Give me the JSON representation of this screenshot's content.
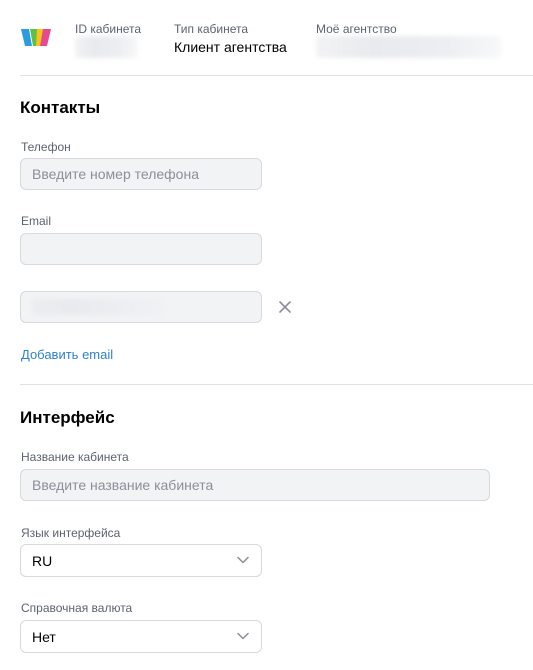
{
  "header": {
    "logo": "colorful-bars-logo",
    "cabinet_id_label": "ID кабинета",
    "cabinet_type_label": "Тип кабинета",
    "cabinet_type_value": "Клиент агентства",
    "agency_label": "Моё агентство"
  },
  "contacts": {
    "title": "Контакты",
    "phone_label": "Телефон",
    "phone_placeholder": "Введите номер телефона",
    "email_label": "Email",
    "email_value": "",
    "add_email": "Добавить email",
    "remove_icon": "close-icon"
  },
  "interface": {
    "title": "Интерфейс",
    "name_label": "Название кабинета",
    "name_placeholder": "Введите название кабинета",
    "language_label": "Язык интерфейса",
    "language_value": "RU",
    "currency_label": "Справочная валюта",
    "currency_value": "Нет"
  },
  "colors": {
    "link": "#2f80d0",
    "input_bg": "#f2f3f5",
    "border": "#d7d9de",
    "muted_text": "#5c6270"
  }
}
